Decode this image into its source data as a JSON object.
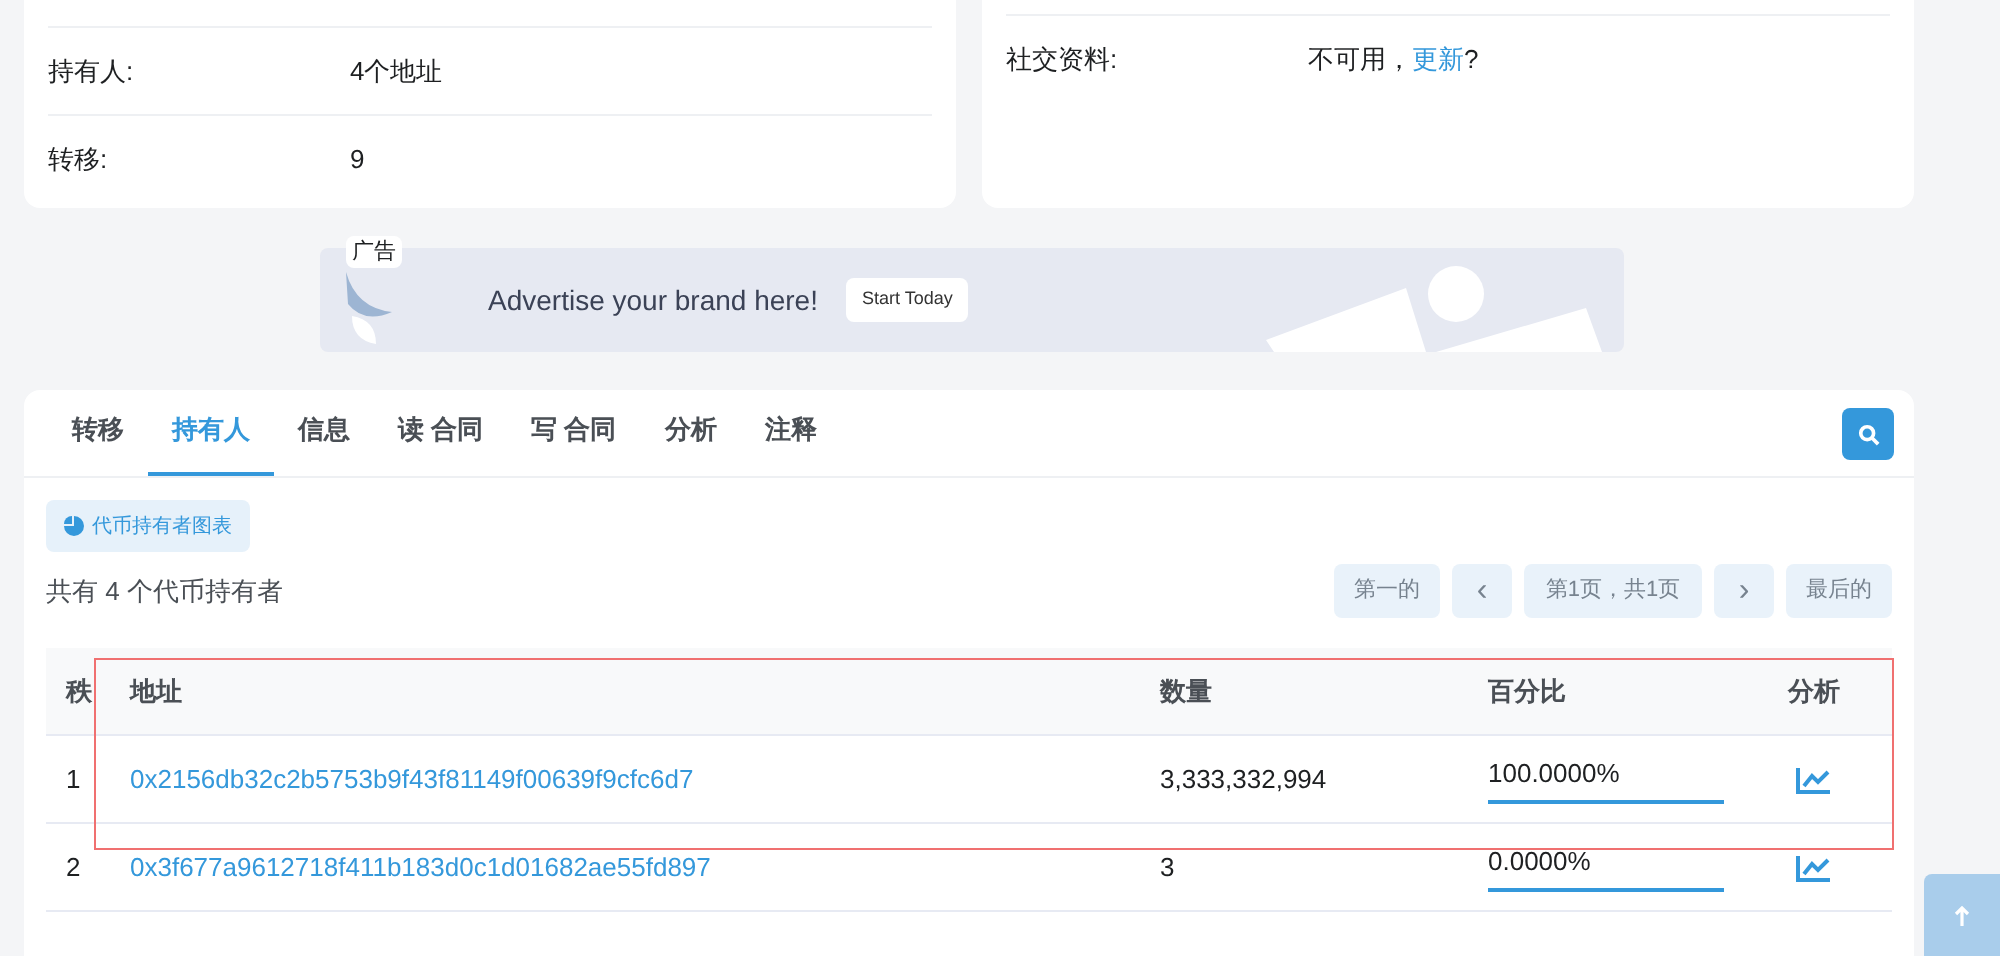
{
  "overview": {
    "rows": [
      {
        "label": "持有人:",
        "value": "4个地址"
      },
      {
        "label": "转移:",
        "value": "9"
      }
    ]
  },
  "profile": {
    "label": "社交资料:",
    "value": "不可用，",
    "link": "更新",
    "suffix": "?"
  },
  "ad": {
    "badge": "广告",
    "text": "Advertise your brand here!",
    "button": "Start Today"
  },
  "tabs": [
    {
      "label": "转移",
      "selected": false
    },
    {
      "label": "持有人",
      "selected": true
    },
    {
      "label": "信息",
      "selected": false
    },
    {
      "label": "读 合同",
      "selected": false
    },
    {
      "label": "写 合同",
      "selected": false
    },
    {
      "label": "分析",
      "selected": false
    },
    {
      "label": "注释",
      "selected": false
    }
  ],
  "chart_button": "代币持有者图表",
  "summary": "共有 4 个代币持有者",
  "pagination": {
    "first": "第一的",
    "prev": "‹",
    "page": "第1页，共1页",
    "next": "›",
    "last": "最后的"
  },
  "table": {
    "columns": [
      "秩",
      "地址",
      "数量",
      "百分比",
      "分析"
    ],
    "rows": [
      {
        "rank": "1",
        "address": "0x2156db32c2b5753b9f43f81149f00639f9cfc6d7",
        "quantity": "3,333,332,994",
        "percentage": "100.0000%"
      },
      {
        "rank": "2",
        "address": "0x3f677a9612718f411b183d0c1d01682ae55fd897",
        "quantity": "3",
        "percentage": "0.0000%"
      }
    ]
  }
}
